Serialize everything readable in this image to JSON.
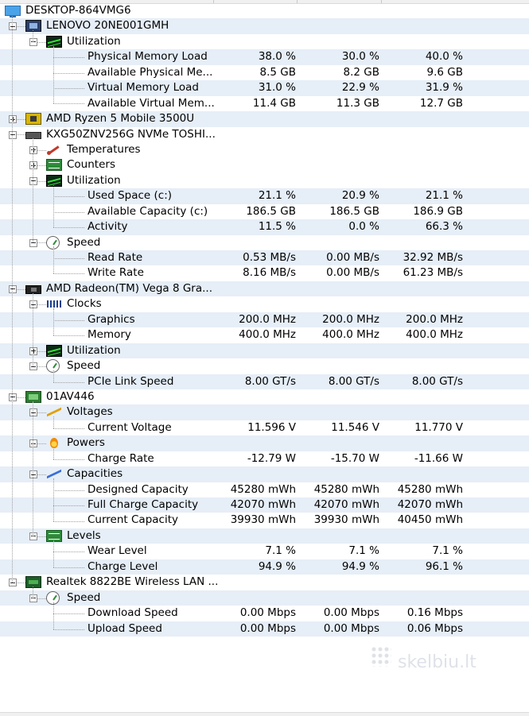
{
  "tree": {
    "root": {
      "label": "DESKTOP-864VMG6",
      "icon": "computer-icon"
    },
    "rows": [
      {
        "name": "node-lenovo",
        "level": 1,
        "expander": "minus",
        "icon": "mb",
        "label": "LENOVO 20NE001GMH",
        "shade": true
      },
      {
        "name": "node-utilization",
        "level": 2,
        "expander": "minus",
        "icon": "util",
        "label": "Utilization"
      },
      {
        "name": "sensor-row",
        "level": 3,
        "label": "Physical Memory Load",
        "value": "38.0 %",
        "min": "30.0 %",
        "max": "40.0 %",
        "shade": true
      },
      {
        "name": "sensor-row",
        "level": 3,
        "label": "Available Physical Me...",
        "value": "8.5 GB",
        "min": "8.2 GB",
        "max": "9.6 GB"
      },
      {
        "name": "sensor-row",
        "level": 3,
        "label": "Virtual Memory Load",
        "value": "31.0 %",
        "min": "22.9 %",
        "max": "31.9 %",
        "shade": true
      },
      {
        "name": "sensor-row",
        "level": 3,
        "label": "Available Virtual Mem...",
        "value": "11.4 GB",
        "min": "11.3 GB",
        "max": "12.7 GB"
      },
      {
        "name": "node-cpu",
        "level": 1,
        "expander": "plus",
        "icon": "cpu",
        "label": "AMD Ryzen 5 Mobile 3500U",
        "shade": true
      },
      {
        "name": "node-nvme",
        "level": 1,
        "expander": "minus",
        "icon": "disk",
        "label": "KXG50ZNV256G NVMe TOSHI..."
      },
      {
        "name": "node-temperatures",
        "level": 2,
        "expander": "plus",
        "icon": "temp",
        "label": "Temperatures"
      },
      {
        "name": "node-counters",
        "level": 2,
        "expander": "plus",
        "icon": "counter",
        "label": "Counters"
      },
      {
        "name": "node-utilization",
        "level": 2,
        "expander": "minus",
        "icon": "util",
        "label": "Utilization"
      },
      {
        "name": "sensor-row",
        "level": 3,
        "label": "Used Space (c:)",
        "value": "21.1 %",
        "min": "20.9 %",
        "max": "21.1 %",
        "shade": true
      },
      {
        "name": "sensor-row",
        "level": 3,
        "label": "Available Capacity (c:)",
        "value": "186.5 GB",
        "min": "186.5 GB",
        "max": "186.9 GB"
      },
      {
        "name": "sensor-row",
        "level": 3,
        "label": "Activity",
        "value": "11.5 %",
        "min": "0.0 %",
        "max": "66.3 %",
        "shade": true
      },
      {
        "name": "node-speed",
        "level": 2,
        "expander": "minus",
        "icon": "speed",
        "label": "Speed"
      },
      {
        "name": "sensor-row",
        "level": 3,
        "label": "Read Rate",
        "value": "0.53 MB/s",
        "min": "0.00 MB/s",
        "max": "32.92 MB/s",
        "shade": true
      },
      {
        "name": "sensor-row",
        "level": 3,
        "label": "Write Rate",
        "value": "8.16 MB/s",
        "min": "0.00 MB/s",
        "max": "61.23 MB/s"
      },
      {
        "name": "node-gpu",
        "level": 1,
        "expander": "minus",
        "icon": "gpu",
        "label": "AMD Radeon(TM) Vega 8 Gra...",
        "shade": true
      },
      {
        "name": "node-clocks",
        "level": 2,
        "expander": "minus",
        "icon": "clock",
        "label": "Clocks"
      },
      {
        "name": "sensor-row",
        "level": 3,
        "label": "Graphics",
        "value": "200.0 MHz",
        "min": "200.0 MHz",
        "max": "200.0 MHz",
        "shade": true
      },
      {
        "name": "sensor-row",
        "level": 3,
        "label": "Memory",
        "value": "400.0 MHz",
        "min": "400.0 MHz",
        "max": "400.0 MHz"
      },
      {
        "name": "node-utilization",
        "level": 2,
        "expander": "plus",
        "icon": "util",
        "label": "Utilization",
        "shade": true
      },
      {
        "name": "node-speed",
        "level": 2,
        "expander": "minus",
        "icon": "speed",
        "label": "Speed"
      },
      {
        "name": "sensor-row",
        "level": 3,
        "label": "PCIe Link Speed",
        "value": "8.00 GT/s",
        "min": "8.00 GT/s",
        "max": "8.00 GT/s",
        "shade": true
      },
      {
        "name": "node-battery",
        "level": 1,
        "expander": "minus",
        "icon": "bat",
        "label": "01AV446"
      },
      {
        "name": "node-voltages",
        "level": 2,
        "expander": "minus",
        "icon": "volt",
        "label": "Voltages",
        "shade": true
      },
      {
        "name": "sensor-row",
        "level": 3,
        "label": "Current Voltage",
        "value": "11.596 V",
        "min": "11.546 V",
        "max": "11.770 V"
      },
      {
        "name": "node-powers",
        "level": 2,
        "expander": "minus",
        "icon": "power",
        "label": "Powers",
        "shade": true
      },
      {
        "name": "sensor-row",
        "level": 3,
        "label": "Charge Rate",
        "value": "-12.79 W",
        "min": "-15.70 W",
        "max": "-11.66 W"
      },
      {
        "name": "node-capacities",
        "level": 2,
        "expander": "minus",
        "icon": "cap",
        "label": "Capacities",
        "shade": true
      },
      {
        "name": "sensor-row",
        "level": 3,
        "label": "Designed Capacity",
        "value": "45280 mWh",
        "min": "45280 mWh",
        "max": "45280 mWh"
      },
      {
        "name": "sensor-row",
        "level": 3,
        "label": "Full Charge Capacity",
        "value": "42070 mWh",
        "min": "42070 mWh",
        "max": "42070 mWh",
        "shade": true
      },
      {
        "name": "sensor-row",
        "level": 3,
        "label": "Current Capacity",
        "value": "39930 mWh",
        "min": "39930 mWh",
        "max": "40450 mWh"
      },
      {
        "name": "node-levels",
        "level": 2,
        "expander": "minus",
        "icon": "levels",
        "label": "Levels",
        "shade": true
      },
      {
        "name": "sensor-row",
        "level": 3,
        "label": "Wear Level",
        "value": "7.1 %",
        "min": "7.1 %",
        "max": "7.1 %"
      },
      {
        "name": "sensor-row",
        "level": 3,
        "label": "Charge Level",
        "value": "94.9 %",
        "min": "94.9 %",
        "max": "96.1 %",
        "shade": true
      },
      {
        "name": "node-network",
        "level": 1,
        "expander": "minus",
        "icon": "net",
        "label": "Realtek 8822BE Wireless LAN ..."
      },
      {
        "name": "node-speed",
        "level": 2,
        "expander": "minus",
        "icon": "speed",
        "label": "Speed",
        "shade": true
      },
      {
        "name": "sensor-row",
        "level": 3,
        "label": "Download Speed",
        "value": "0.00 Mbps",
        "min": "0.00 Mbps",
        "max": "0.16 Mbps"
      },
      {
        "name": "sensor-row",
        "level": 3,
        "label": "Upload Speed",
        "value": "0.00 Mbps",
        "min": "0.00 Mbps",
        "max": "0.06 Mbps",
        "shade": true
      }
    ]
  },
  "watermark": "skelbiu.lt",
  "colors": {
    "row_shade": "#e6eef7",
    "tree_line": "#a0a0a0"
  }
}
